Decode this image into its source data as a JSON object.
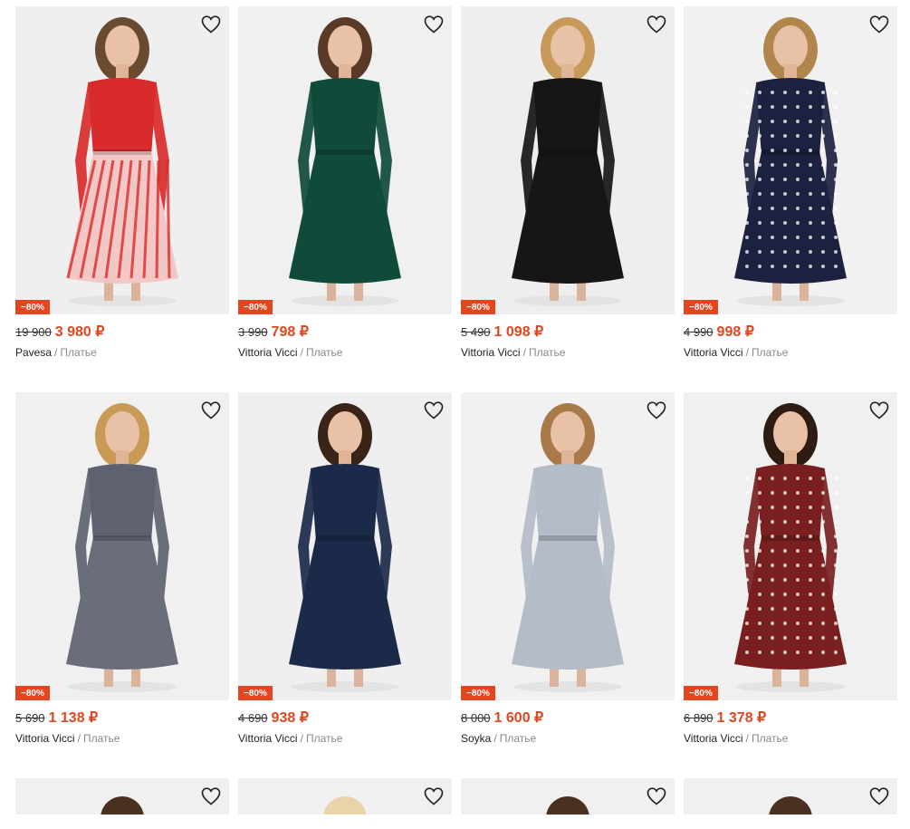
{
  "products": [
    {
      "old_price": "19 900",
      "price": "3 980 ₽",
      "discount": "−80%",
      "brand": "Pavesa",
      "category": "Платье",
      "dress_color": "#d92b2b",
      "skirt_color": "#f4c7c7",
      "hair": "#6b4a32",
      "bg": "#efefef"
    },
    {
      "old_price": "3 990",
      "price": "798 ₽",
      "discount": "−80%",
      "brand": "Vittoria Vicci",
      "category": "Платье",
      "dress_color": "#0f4a3a",
      "skirt_color": "#0f4a3a",
      "hair": "#5a3a26",
      "bg": "#f0f0f0"
    },
    {
      "old_price": "5 490",
      "price": "1 098 ₽",
      "discount": "−80%",
      "brand": "Vittoria Vicci",
      "category": "Платье",
      "dress_color": "#161616",
      "skirt_color": "#161616",
      "hair": "#c89a5a",
      "bg": "#eeeeee"
    },
    {
      "old_price": "4 990",
      "price": "998 ₽",
      "discount": "−80%",
      "brand": "Vittoria Vicci",
      "category": "Платье",
      "dress_color": "#1c2140",
      "skirt_color": "#1c2140",
      "hair": "#b0864c",
      "bg": "#f1f1f1"
    },
    {
      "old_price": "5 690",
      "price": "1 138 ₽",
      "discount": "−80%",
      "brand": "Vittoria Vicci",
      "category": "Платье",
      "dress_color": "#5e6270",
      "skirt_color": "#6a6e7a",
      "hair": "#c99a55",
      "bg": "#f0f0f0"
    },
    {
      "old_price": "4 690",
      "price": "938 ₽",
      "discount": "−80%",
      "brand": "Vittoria Vicci",
      "category": "Платье",
      "dress_color": "#1c2a4a",
      "skirt_color": "#1c2a4a",
      "hair": "#3a2418",
      "bg": "#efefef"
    },
    {
      "old_price": "8 000",
      "price": "1 600 ₽",
      "discount": "−80%",
      "brand": "Soyka",
      "category": "Платье",
      "dress_color": "#b4bcc8",
      "skirt_color": "#b4bcc8",
      "hair": "#a87a4a",
      "bg": "#f1f1f1"
    },
    {
      "old_price": "6 890",
      "price": "1 378 ₽",
      "discount": "−80%",
      "brand": "Vittoria Vicci",
      "category": "Платье",
      "dress_color": "#7a1f1f",
      "skirt_color": "#7a1f1f",
      "hair": "#2e1c12",
      "bg": "#f0f0f0"
    }
  ],
  "partial_row": [
    {
      "bg": "#f0f0f0"
    },
    {
      "bg": "#f0f0f0"
    },
    {
      "bg": "#f0f0f0"
    },
    {
      "bg": "#f0f0f0"
    }
  ],
  "icons": {
    "favorite": "heart-outline-icon"
  }
}
